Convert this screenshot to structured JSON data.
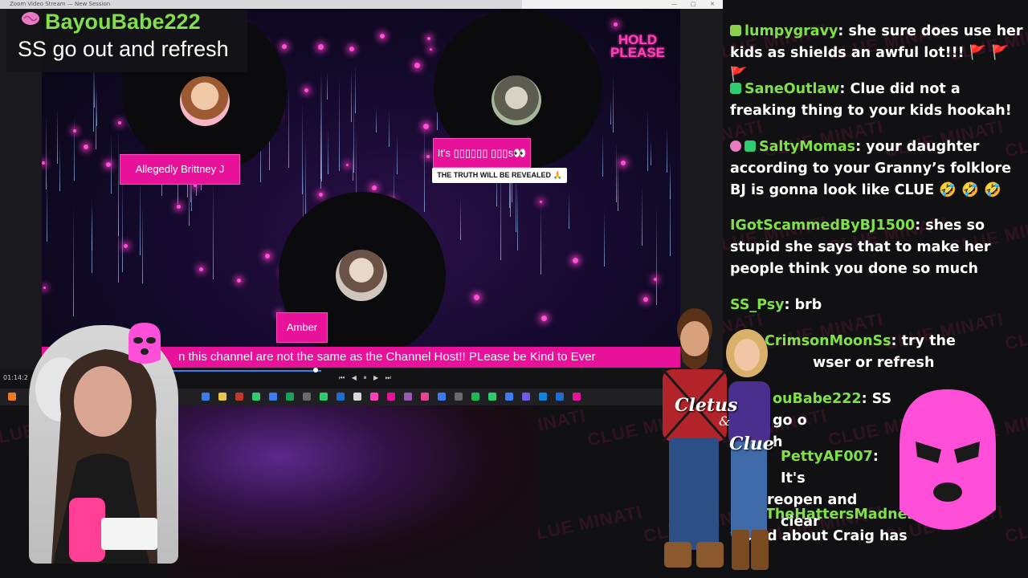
{
  "window": {
    "title": "Zoom Video Stream — New Session",
    "minimize_label": "—",
    "maximize_label": "□",
    "close_label": "✕"
  },
  "stream_overlay": {
    "hold_line1": "HOLD",
    "hold_line2": "PLEASE",
    "marquee_text": "n this channel are not the same as the Channel Host!! PLease be Kind to Ever"
  },
  "participants": [
    {
      "name": "Allegedly Brittney J"
    },
    {
      "name": "It's ▯▯▯▯▯▯ ▯▯▯s👀",
      "subtitle": "THE TRUTH WILL BE REVEALED 🙏"
    },
    {
      "name": "Amber"
    }
  ],
  "player": {
    "timecode": "01:14:2",
    "controls": "⏮ ◀ ⏸ ▶ ⏭"
  },
  "featured_message": {
    "user": "BayouBabe222",
    "text": "SS go out and refresh"
  },
  "watermark": "CLUE MINATI",
  "cast_labels": {
    "left": "Cletus",
    "amp": "&",
    "right": "Clue"
  },
  "chat": [
    {
      "user": "lumpygravy",
      "text": ": she sure does use her kids as shields an awful lot!!! ",
      "tail": "🚩 🚩 🚩",
      "badge": "#8bd14f"
    },
    {
      "user": "SaneOutlaw",
      "text": ": Clue did not a freaking thing to your kids hookah!",
      "badge": "#2ecc71"
    },
    {
      "user": "SaltyMomas",
      "text": ": your daughter according to your Granny’s folklore BJ is gonna look like CLUE 🤣 🤣 🤣",
      "badge": "#2ecc71"
    },
    {
      "user": "IGotScammedByBJ1500",
      "text": ": shes so stupid she says that to make her people think you done so much"
    },
    {
      "user": "SS_Psy",
      "text": ": brb"
    },
    {
      "user": "CrimsonMoonSs",
      "text": ": try the",
      "text2": "wser or refresh"
    },
    {
      "user": "ouBabe222",
      "text": ": SS go o",
      "text2": "h"
    },
    {
      "user": "PettyAF007",
      "text": ": It's",
      "text2": "reopen and clear"
    },
    {
      "user": "TheHattersMadness",
      "text": "",
      "text2": "wo   ed about Craig has"
    }
  ],
  "colors": {
    "accent": "#e8129a",
    "chat_user": "#7fe04a",
    "hold": "#ff3fb5"
  }
}
